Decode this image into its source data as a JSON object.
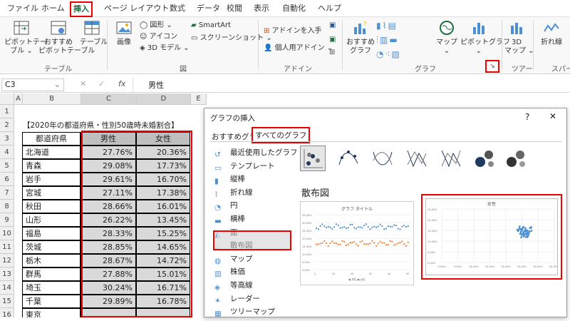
{
  "ribbon_tabs": [
    "ファイル",
    "ホーム",
    "挿入",
    "ページ レイアウト",
    "数式",
    "データ",
    "校閲",
    "表示",
    "自動化",
    "ヘルプ"
  ],
  "ribbon": {
    "pivot_table": "ピボットテー\nブル ⌄",
    "recommended_pivot": "おすすめ\nピボットテーブル",
    "table": "テーブル",
    "group_table": "テーブル",
    "image": "画像",
    "shapes": "図形 ⌄",
    "icons": "アイコン",
    "models3d": "3D モデル ⌄",
    "smartart": "SmartArt",
    "screenshot": "スクリーンショット ⌄",
    "group_figure": "図",
    "get_addins": "アドインを入手",
    "my_addins": "個人用アドイン ⌄",
    "group_addins": "アドイン",
    "recommended_charts": "おすすめ\nグラフ",
    "maps": "マップ\n⌄",
    "pivot_chart": "ピボットグラフ\n⌄",
    "group_charts": "グラフ",
    "map3d": "3D\nマップ ⌄",
    "group_tour": "ツアー",
    "line_spark": "折れ線",
    "group_spark": "スパー"
  },
  "formula_bar": {
    "namebox": "C3",
    "fx": "fx",
    "value": "男性"
  },
  "columns": [
    "A",
    "B",
    "C",
    "D",
    "E"
  ],
  "rows": [
    "1",
    "2",
    "3",
    "4",
    "5",
    "6",
    "7",
    "8",
    "9",
    "10",
    "11",
    "12",
    "13",
    "14",
    "15",
    "16"
  ],
  "sheet_title": "【2020年の都道府県・性別50歳時未婚割合】",
  "table_headers": [
    "都道府県",
    "男性",
    "女性"
  ],
  "table_rows": [
    [
      "北海道",
      "27.76%",
      "20.36%"
    ],
    [
      "青森",
      "29.08%",
      "17.73%"
    ],
    [
      "岩手",
      "29.61%",
      "16.70%"
    ],
    [
      "宮城",
      "27.11%",
      "17.38%"
    ],
    [
      "秋田",
      "28.66%",
      "16.01%"
    ],
    [
      "山形",
      "26.22%",
      "13.45%"
    ],
    [
      "福島",
      "28.33%",
      "15.25%"
    ],
    [
      "茨城",
      "28.85%",
      "14.65%"
    ],
    [
      "栃木",
      "28.67%",
      "14.72%"
    ],
    [
      "群馬",
      "27.88%",
      "15.01%"
    ],
    [
      "埼玉",
      "30.24%",
      "16.71%"
    ],
    [
      "千葉",
      "29.89%",
      "16.78%"
    ],
    [
      "東京",
      "",
      ""
    ]
  ],
  "dialog": {
    "title": "グラフの挿入",
    "help": "?",
    "close": "✕",
    "tab_recommended": "おすすめグラフ",
    "tab_all": "すべてのグラフ",
    "side_items": [
      "最近使用したグラフ",
      "テンプレート",
      "縦棒",
      "折れ線",
      "円",
      "横棒",
      "面",
      "散布図",
      "マップ",
      "株価",
      "等高線",
      "レーダー",
      "ツリーマップ"
    ],
    "section_title": "散布図",
    "preview1_title": "グラフ タイトル",
    "preview1_legend": "● 男性   ● 女性",
    "preview2_title": "女性",
    "preview1_yticks": [
      "35.00%",
      "30.00%",
      "25.00%",
      "20.00%",
      "15.00%",
      "10.00%",
      "5.00%",
      "0.00%"
    ],
    "preview1_xticks": [
      "0",
      "10",
      "20",
      "30",
      "40",
      "50"
    ],
    "preview2_yticks": [
      "25.00%",
      "20.00%",
      "15.00%",
      "10.00%",
      "5.00%",
      "0.00%"
    ],
    "preview2_xticks": [
      "0.00%",
      "5.00%",
      "10.00%",
      "15.00%",
      "20.00%",
      "25.00%",
      "30.00%",
      "35.00%"
    ]
  },
  "colors": {
    "accent": "#1e6f3f",
    "highlight": "#e00000",
    "sel_fill": "#d0d0d0",
    "series1": "#4e8fd0",
    "series2": "#ed7d31"
  }
}
